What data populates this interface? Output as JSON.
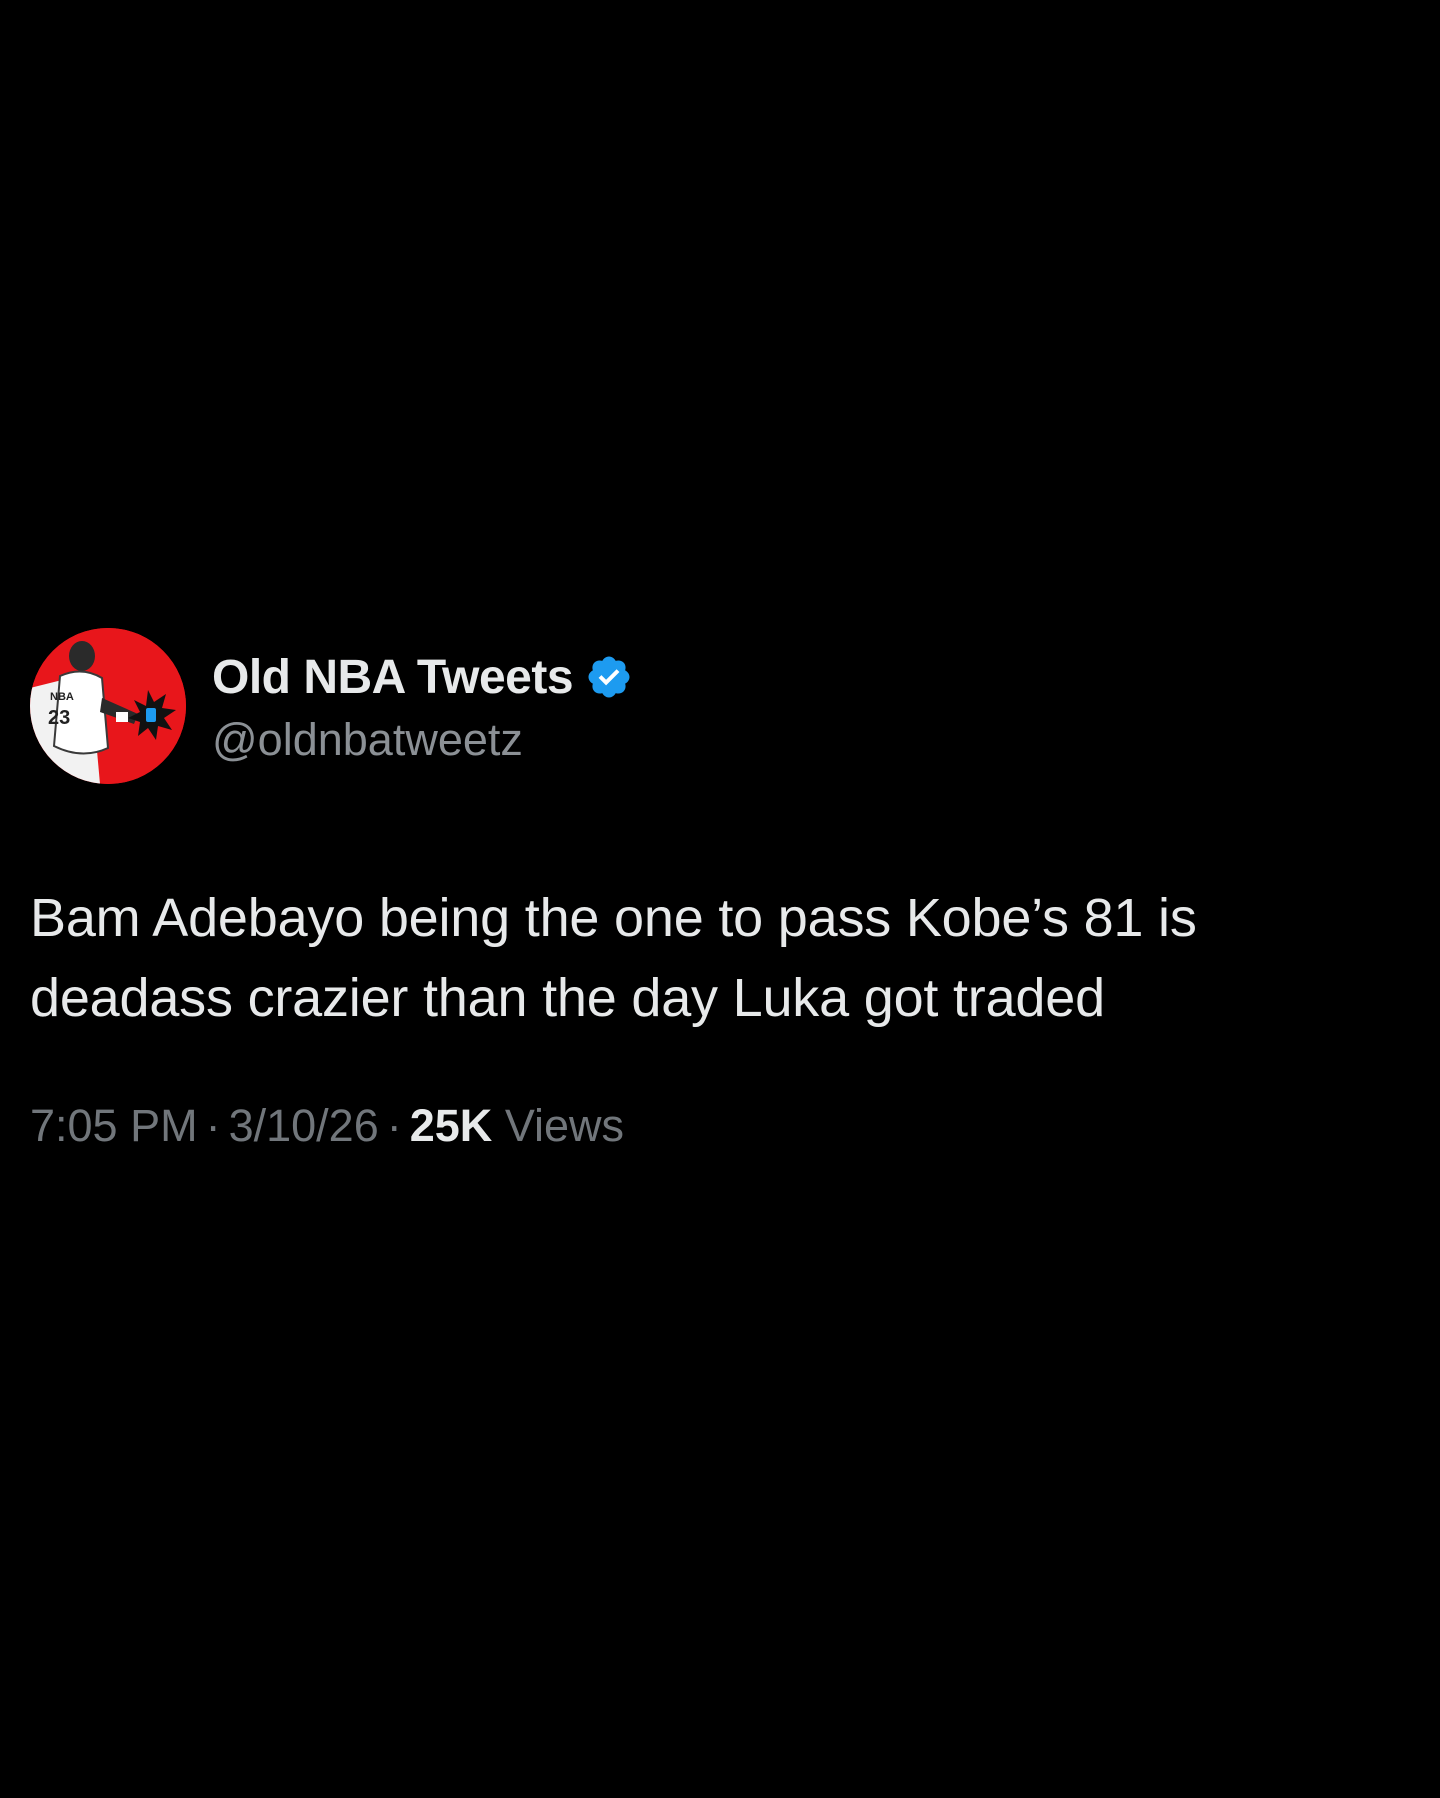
{
  "tweet": {
    "author": {
      "display_name": "Old NBA Tweets",
      "handle": "@oldnbatweetz",
      "verified": true,
      "avatar_icon": "jordan-photo-avatar",
      "avatar_text": "NBA 23"
    },
    "text": "Bam Adebayo being the one to pass Kobe’s 81 is deadass crazier than the day Luka got traded",
    "meta": {
      "time": "7:05 PM",
      "separator": "·",
      "date": "3/10/26",
      "views_count": "25K",
      "views_label": "Views"
    }
  },
  "colors": {
    "background": "#000000",
    "primary_text": "#e7e9ea",
    "secondary_text": "#71767b",
    "verified_blue": "#1d9bf0",
    "avatar_red": "#e8161b"
  }
}
